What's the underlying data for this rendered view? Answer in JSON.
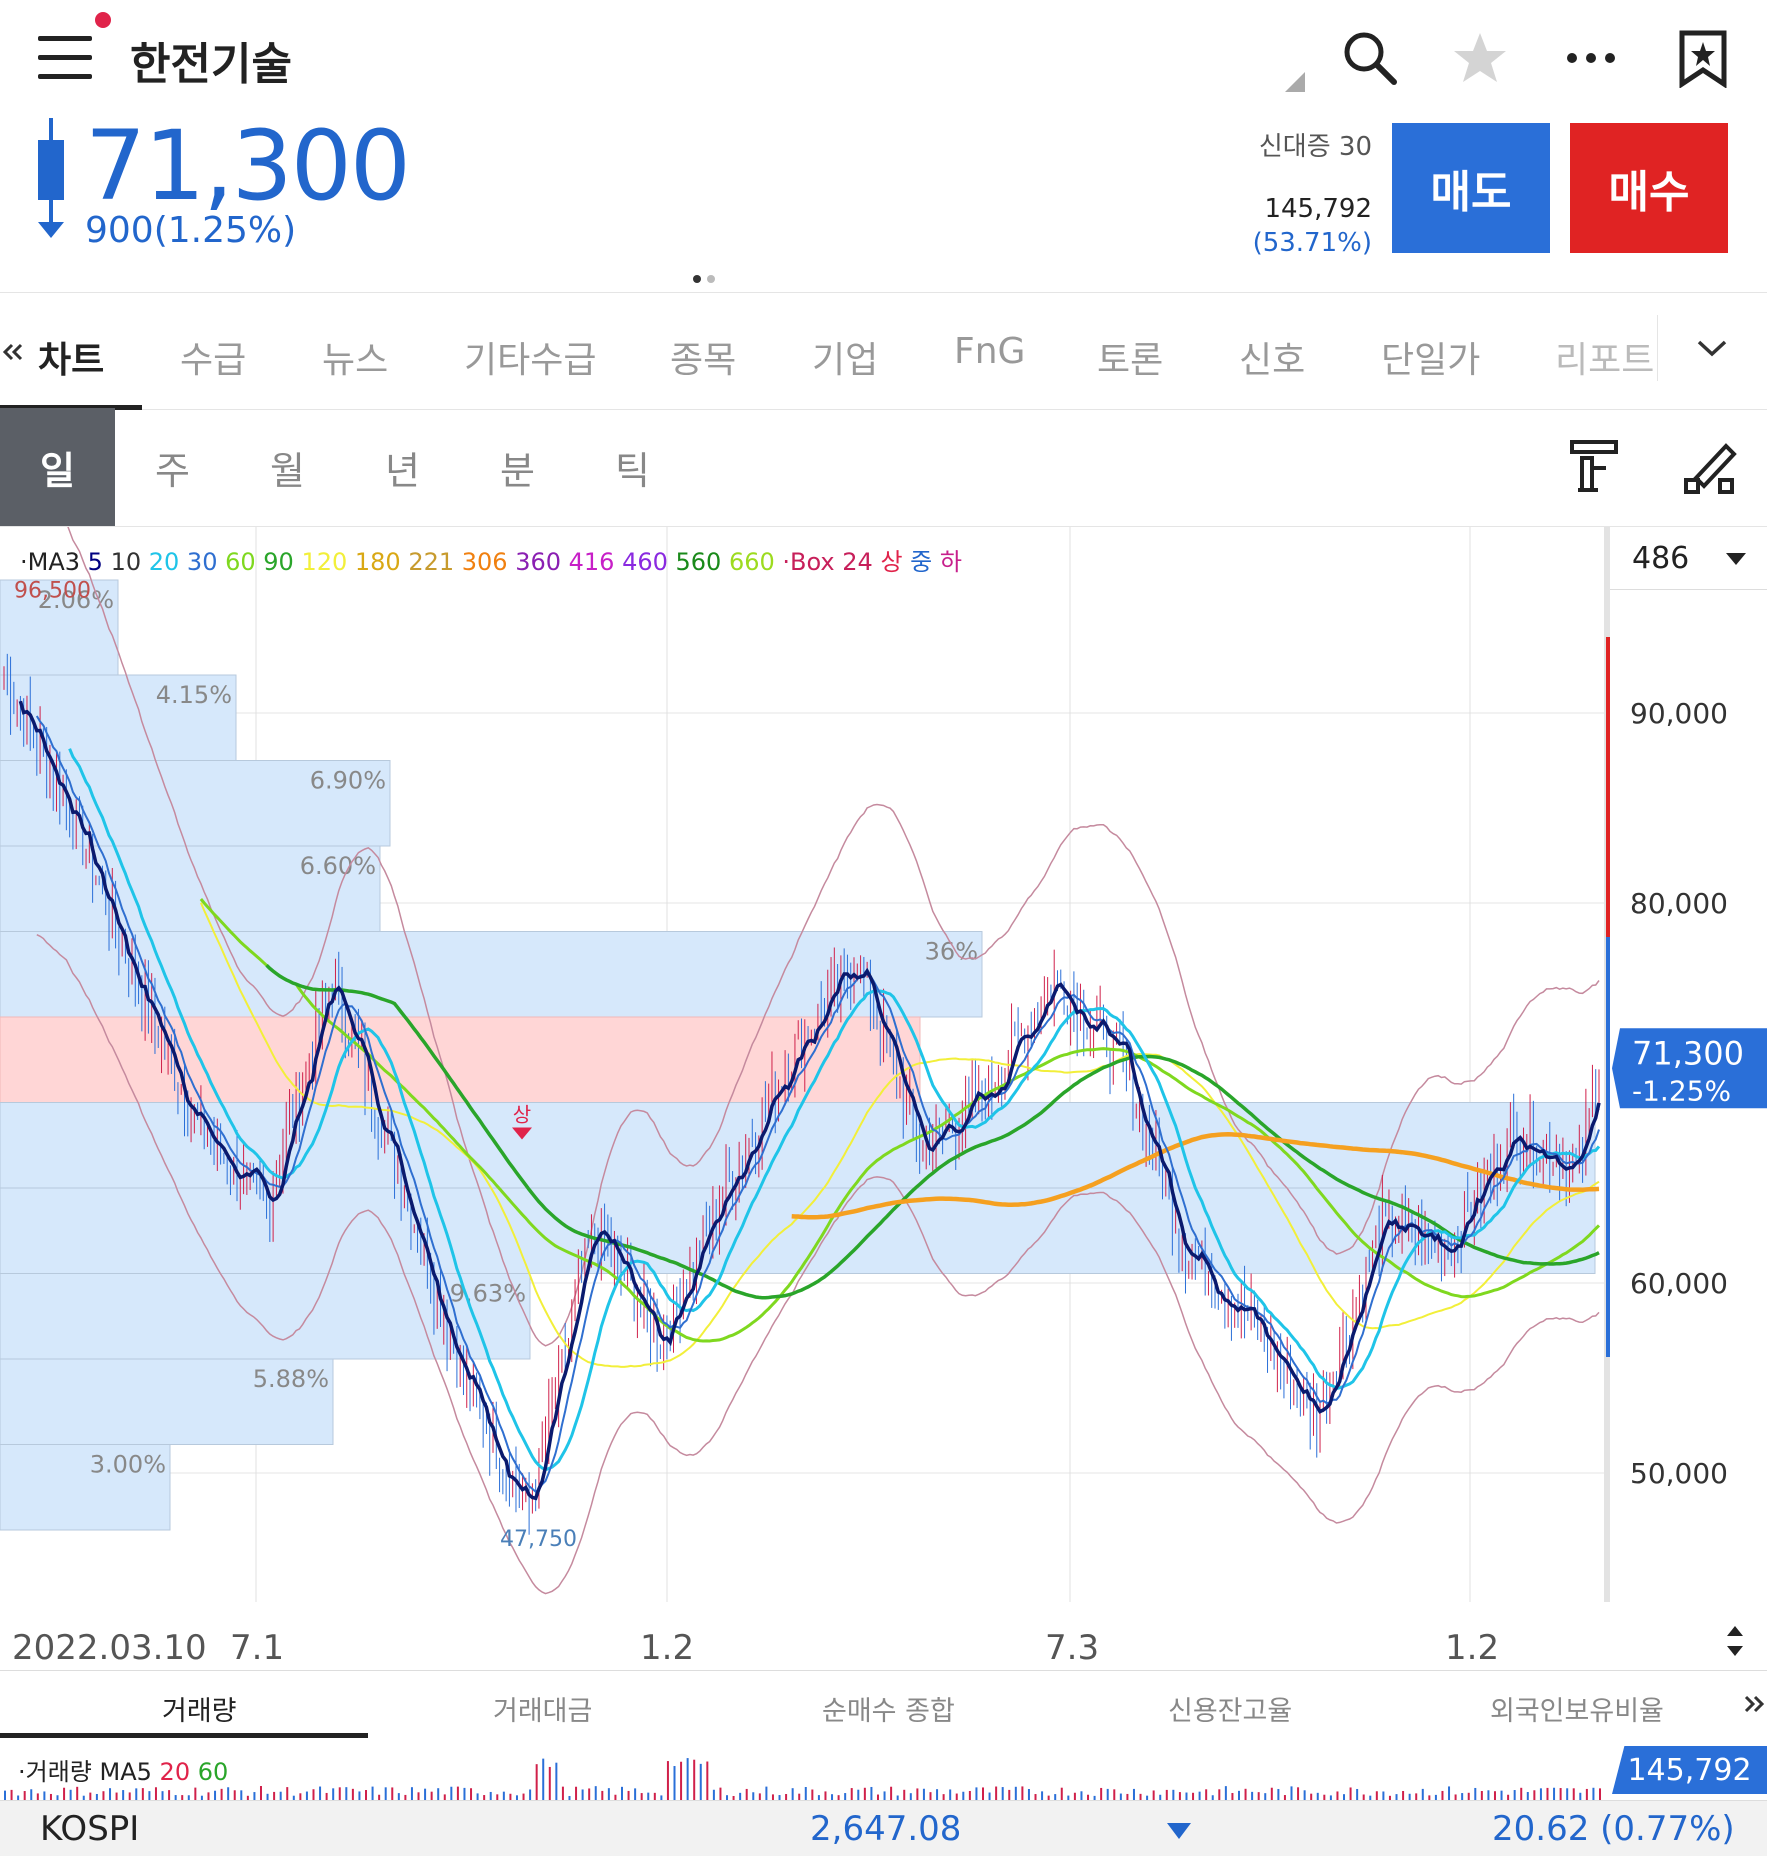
{
  "header": {
    "title": "한전기술",
    "price": "71,300",
    "change": "900(1.25%)",
    "credit_label": "신대증 30",
    "volume": "145,792",
    "volume_ratio": "(53.71%)",
    "sell_label": "매도",
    "buy_label": "매수"
  },
  "tabs": [
    "차트",
    "수급",
    "뉴스",
    "기타수급",
    "종목",
    "기업",
    "FnG",
    "토론",
    "신호",
    "단일가",
    "리포트"
  ],
  "periods": [
    "일",
    "주",
    "월",
    "년",
    "분",
    "틱"
  ],
  "chart": {
    "legend_prefix": "·MA3",
    "legend_ma": [
      {
        "t": "5",
        "c": "#000080"
      },
      {
        "t": "10",
        "c": "#333"
      },
      {
        "t": "20",
        "c": "#1fc4e8"
      },
      {
        "t": "30",
        "c": "#2f6fd0"
      },
      {
        "t": "60",
        "c": "#7fd81f"
      },
      {
        "t": "90",
        "c": "#2aa52a"
      },
      {
        "t": "120",
        "c": "#f2ef3a"
      },
      {
        "t": "180",
        "c": "#d9a814"
      },
      {
        "t": "221",
        "c": "#c79b2e"
      },
      {
        "t": "306",
        "c": "#f08010"
      },
      {
        "t": "360",
        "c": "#8a1fb2"
      },
      {
        "t": "416",
        "c": "#c71fc7"
      },
      {
        "t": "460",
        "c": "#8a2ae0"
      },
      {
        "t": "560",
        "c": "#1a8a1a"
      },
      {
        "t": "660",
        "c": "#9ddb1f"
      }
    ],
    "legend_box": "·Box 24",
    "legend_box_items": [
      {
        "t": "상",
        "c": "#e0234a"
      },
      {
        "t": "중",
        "c": "#2266cc"
      },
      {
        "t": "하",
        "c": "#c71f8c"
      }
    ],
    "bars_count": "486",
    "high_label": "96,500",
    "low_label": "47,750",
    "marker_label": "상",
    "y_ticks": [
      "90,000",
      "80,000",
      "60,000",
      "50,000"
    ],
    "last_price": "71,300",
    "last_change": "-1.25%",
    "x_labels": [
      "2022.03.10",
      "7.1",
      "1.2",
      "7.3",
      "1.2"
    ],
    "box_pcts": [
      "2.06%",
      "4.15%",
      "6.90%",
      "6.60%",
      "36%",
      "9.63%",
      "5.88%",
      "3.00%"
    ],
    "colors": {
      "candle_up": "#d0204a",
      "candle_down": "#2a6fd8",
      "range_up": "#e0234a",
      "range_down": "#2a6fd8"
    }
  },
  "chart_data": {
    "type": "line",
    "y_ticks": [
      90000,
      80000,
      60000,
      50000
    ],
    "ylim": [
      44000,
      99000
    ],
    "x_labels": [
      "2022.03.10",
      "7.1",
      "1.2",
      "7.3",
      "1.2"
    ],
    "series": [
      {
        "name": "5",
        "x": [
          0,
          20,
          40,
          60,
          80,
          100,
          120,
          140,
          160,
          180,
          200,
          220,
          240,
          260,
          280,
          300,
          320,
          340,
          360,
          380,
          400,
          420,
          440,
          460,
          480,
          486
        ],
        "values": [
          92000,
          85000,
          76000,
          68000,
          64000,
          76000,
          66000,
          55000,
          48000,
          63000,
          57000,
          65000,
          72000,
          77000,
          67000,
          70000,
          76000,
          72000,
          62000,
          58000,
          53000,
          63000,
          62000,
          68000,
          66000,
          71300
        ]
      }
    ],
    "high": 96500,
    "low": 47750,
    "last": 71300
  },
  "indicator_tabs": [
    "거래량",
    "거래대금",
    "순매수 종합",
    "신용잔고율",
    "외국인보유비율"
  ],
  "volume": {
    "legend_prefix": "·거래량 MA5",
    "ma_items": [
      {
        "t": "20",
        "c": "#e0234a"
      },
      {
        "t": "60",
        "c": "#2aa52a"
      }
    ],
    "current": "145,792"
  },
  "index": {
    "name": "KOSPI",
    "value": "2,647.08",
    "change": "20.62 (0.77%)"
  }
}
